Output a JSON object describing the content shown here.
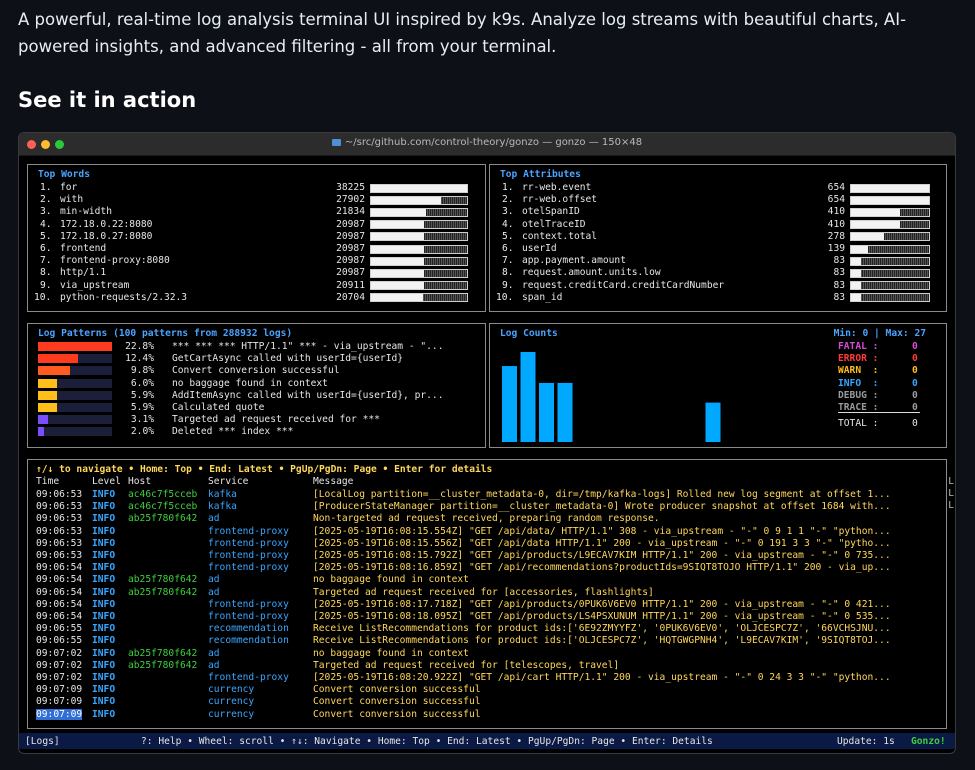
{
  "intro_text": "A powerful, real-time log analysis terminal UI inspired by k9s. Analyze log streams with beautiful charts, AI-powered insights, and advanced filtering - all from your terminal.",
  "section_heading": "See it in action",
  "window": {
    "title": "~/src/github.com/control-theory/gonzo — gonzo — 150×48"
  },
  "top_words": {
    "title": "Top Words",
    "max": 38225,
    "items": [
      {
        "rank": "1.",
        "word": "for",
        "count": "38225",
        "value": 38225
      },
      {
        "rank": "2.",
        "word": "with",
        "count": "27902",
        "value": 27902
      },
      {
        "rank": "3.",
        "word": "min-width",
        "count": "21834",
        "value": 21834
      },
      {
        "rank": "4.",
        "word": "172.18.0.22:8080",
        "count": "20987",
        "value": 20987
      },
      {
        "rank": "5.",
        "word": "172.18.0.27:8080",
        "count": "20987",
        "value": 20987
      },
      {
        "rank": "6.",
        "word": "frontend",
        "count": "20987",
        "value": 20987
      },
      {
        "rank": "7.",
        "word": "frontend-proxy:8080",
        "count": "20987",
        "value": 20987
      },
      {
        "rank": "8.",
        "word": "http/1.1",
        "count": "20987",
        "value": 20987
      },
      {
        "rank": "9.",
        "word": "via_upstream",
        "count": "20911",
        "value": 20911
      },
      {
        "rank": "10.",
        "word": "python-requests/2.32.3",
        "count": "20704",
        "value": 20704
      }
    ]
  },
  "top_attributes": {
    "title": "Top Attributes",
    "max": 654,
    "items": [
      {
        "rank": "1.",
        "word": "rr-web.event",
        "count": "654",
        "value": 654
      },
      {
        "rank": "2.",
        "word": "rr-web.offset",
        "count": "654",
        "value": 654
      },
      {
        "rank": "3.",
        "word": "otelSpanID",
        "count": "410",
        "value": 410
      },
      {
        "rank": "4.",
        "word": "otelTraceID",
        "count": "410",
        "value": 410
      },
      {
        "rank": "5.",
        "word": "context.total",
        "count": "278",
        "value": 278
      },
      {
        "rank": "6.",
        "word": "userId",
        "count": "139",
        "value": 139
      },
      {
        "rank": "7.",
        "word": "app.payment.amount",
        "count": "83",
        "value": 83
      },
      {
        "rank": "8.",
        "word": "request.amount.units.low",
        "count": "83",
        "value": 83
      },
      {
        "rank": "9.",
        "word": "request.creditCard.creditCardNumber",
        "count": "83",
        "value": 83
      },
      {
        "rank": "10.",
        "word": "span_id",
        "count": "83",
        "value": 83
      }
    ]
  },
  "log_patterns": {
    "title": "Log Patterns (100 patterns from 288932 logs)",
    "items": [
      {
        "pct": "22.8%",
        "value": 22.8,
        "color": "#ff3b1f",
        "text": "*** *** *** HTTP/1.1\" *** - via_upstream - \"..."
      },
      {
        "pct": "12.4%",
        "value": 12.4,
        "color": "#ff3b1f",
        "text": "GetCartAsync called with userId={userId}"
      },
      {
        "pct": "9.8%",
        "value": 9.8,
        "color": "#ff5a1f",
        "text": "Convert conversion successful"
      },
      {
        "pct": "6.0%",
        "value": 6.0,
        "color": "#ffbe1a",
        "text": "no baggage found in context"
      },
      {
        "pct": "5.9%",
        "value": 5.9,
        "color": "#ffbe1a",
        "text": "AddItemAsync called with userId={userId}, pr..."
      },
      {
        "pct": "5.9%",
        "value": 5.9,
        "color": "#ffbe1a",
        "text": "Calculated quote"
      },
      {
        "pct": "3.1%",
        "value": 3.1,
        "color": "#7a4dff",
        "text": "Targeted ad request received for ***"
      },
      {
        "pct": "2.0%",
        "value": 2.0,
        "color": "#7a4dff",
        "text": "Deleted *** index ***"
      }
    ]
  },
  "log_counts": {
    "title": "Log Counts",
    "minmax": "Min: 0 | Max: 27",
    "chart_values": [
      27,
      32,
      21,
      21,
      0,
      0,
      0,
      0,
      0,
      0,
      0,
      14
    ],
    "chart_max": 32,
    "levels": [
      {
        "label": "FATAL :",
        "count": "0",
        "color": "#d64bd6"
      },
      {
        "label": "ERROR :",
        "count": "0",
        "color": "#ff3b3b"
      },
      {
        "label": "WARN  :",
        "count": "0",
        "color": "#ffbe1a"
      },
      {
        "label": "INFO  :",
        "count": "0",
        "color": "#38a6ff"
      },
      {
        "label": "DEBUG :",
        "count": "0",
        "color": "#9a9a9a"
      },
      {
        "label": "TRACE :",
        "count": "0",
        "color": "#9a9a9a"
      }
    ],
    "total_label": "TOTAL :",
    "total": "0"
  },
  "log_table": {
    "hint": "↑/↓ to navigate • Home: Top • End: Latest • PgUp/PgDn: Page • Enter for details",
    "headers": {
      "time": "Time",
      "level": "Level",
      "host": "Host",
      "service": "Service",
      "message": "Message"
    },
    "rows": [
      {
        "time": "09:06:53",
        "level": "INFO",
        "host": "ac46c7f5cceb",
        "service": "kafka",
        "message": "[LocalLog partition=__cluster_metadata-0, dir=/tmp/kafka-logs] Rolled new log segment at offset 1..."
      },
      {
        "time": "09:06:53",
        "level": "INFO",
        "host": "ac46c7f5cceb",
        "service": "kafka",
        "message": "[ProducerStateManager partition=__cluster_metadata-0] Wrote producer snapshot at offset 1684 with..."
      },
      {
        "time": "09:06:53",
        "level": "INFO",
        "host": "ab25f780f642",
        "service": "ad",
        "message": "Non-targeted ad request received, preparing random response."
      },
      {
        "time": "09:06:53",
        "level": "INFO",
        "host": "",
        "service": "frontend-proxy",
        "message": "[2025-05-19T16:08:15.554Z] \"GET /api/data/ HTTP/1.1\" 308 - via_upstream - \"-\" 0 9 1 1 \"-\" \"python..."
      },
      {
        "time": "09:06:53",
        "level": "INFO",
        "host": "",
        "service": "frontend-proxy",
        "message": "[2025-05-19T16:08:15.556Z] \"GET /api/data HTTP/1.1\" 200 - via_upstream - \"-\" 0 191 3 3 \"-\" \"pytho..."
      },
      {
        "time": "09:06:53",
        "level": "INFO",
        "host": "",
        "service": "frontend-proxy",
        "message": "[2025-05-19T16:08:15.792Z] \"GET /api/products/L9ECAV7KIM HTTP/1.1\" 200 - via_upstream - \"-\" 0 735..."
      },
      {
        "time": "09:06:54",
        "level": "INFO",
        "host": "",
        "service": "frontend-proxy",
        "message": "[2025-05-19T16:08:16.859Z] \"GET /api/recommendations?productIds=9SIQT8TOJO HTTP/1.1\" 200 - via_up..."
      },
      {
        "time": "09:06:54",
        "level": "INFO",
        "host": "ab25f780f642",
        "service": "ad",
        "message": "no baggage found in context"
      },
      {
        "time": "09:06:54",
        "level": "INFO",
        "host": "ab25f780f642",
        "service": "ad",
        "message": "Targeted ad request received for [accessories, flashlights]"
      },
      {
        "time": "09:06:54",
        "level": "INFO",
        "host": "",
        "service": "frontend-proxy",
        "message": "[2025-05-19T16:08:17.718Z] \"GET /api/products/0PUK6V6EV0 HTTP/1.1\" 200 - via_upstream - \"-\" 0 421..."
      },
      {
        "time": "09:06:54",
        "level": "INFO",
        "host": "",
        "service": "frontend-proxy",
        "message": "[2025-05-19T16:08:18.095Z] \"GET /api/products/LS4PSXUNUM HTTP/1.1\" 200 - via_upstream - \"-\" 0 535..."
      },
      {
        "time": "09:06:55",
        "level": "INFO",
        "host": "",
        "service": "recommendation",
        "message": "Receive ListRecommendations for product ids:['6E92ZMYYFZ', '0PUK6V6EV0', 'OLJCESPC7Z', '66VCHSJNU..."
      },
      {
        "time": "09:06:55",
        "level": "INFO",
        "host": "",
        "service": "recommendation",
        "message": "Receive ListRecommendations for product ids:['OLJCESPC7Z', 'HQTGWGPNH4', 'L9ECAV7KIM', '9SIQT8TOJ..."
      },
      {
        "time": "09:07:02",
        "level": "INFO",
        "host": "ab25f780f642",
        "service": "ad",
        "message": "no baggage found in context"
      },
      {
        "time": "09:07:02",
        "level": "INFO",
        "host": "ab25f780f642",
        "service": "ad",
        "message": "Targeted ad request received for [telescopes, travel]"
      },
      {
        "time": "09:07:02",
        "level": "INFO",
        "host": "",
        "service": "frontend-proxy",
        "message": "[2025-05-19T16:08:20.922Z] \"GET /api/cart HTTP/1.1\" 200 - via_upstream - \"-\" 0 24 3 3 \"-\" \"python..."
      },
      {
        "time": "09:07:09",
        "level": "INFO",
        "host": "",
        "service": "currency",
        "message": "Convert conversion successful"
      },
      {
        "time": "09:07:09",
        "level": "INFO",
        "host": "",
        "service": "currency",
        "message": "Convert conversion successful"
      },
      {
        "time": "09:07:09",
        "level": "INFO",
        "host": "",
        "service": "currency",
        "message": "Convert conversion successful"
      }
    ],
    "edge_chars": [
      "L",
      "L",
      "L"
    ]
  },
  "status_bar": {
    "view": "[Logs]",
    "help": "?: Help • Wheel: scroll • ↑↓: Navigate • Home: Top • End: Latest • PgUp/PgDn: Page • Enter: Details",
    "update": "Update: 1s",
    "brand": "Gonzo!"
  },
  "colors": {
    "accent_blue": "#4aa3ff",
    "host_green": "#3ecf3e",
    "message_yellow": "#ffd75a",
    "info_blue": "#38a6ff",
    "chart_bar": "#00a8ff",
    "status_bg": "#0a1a44"
  }
}
